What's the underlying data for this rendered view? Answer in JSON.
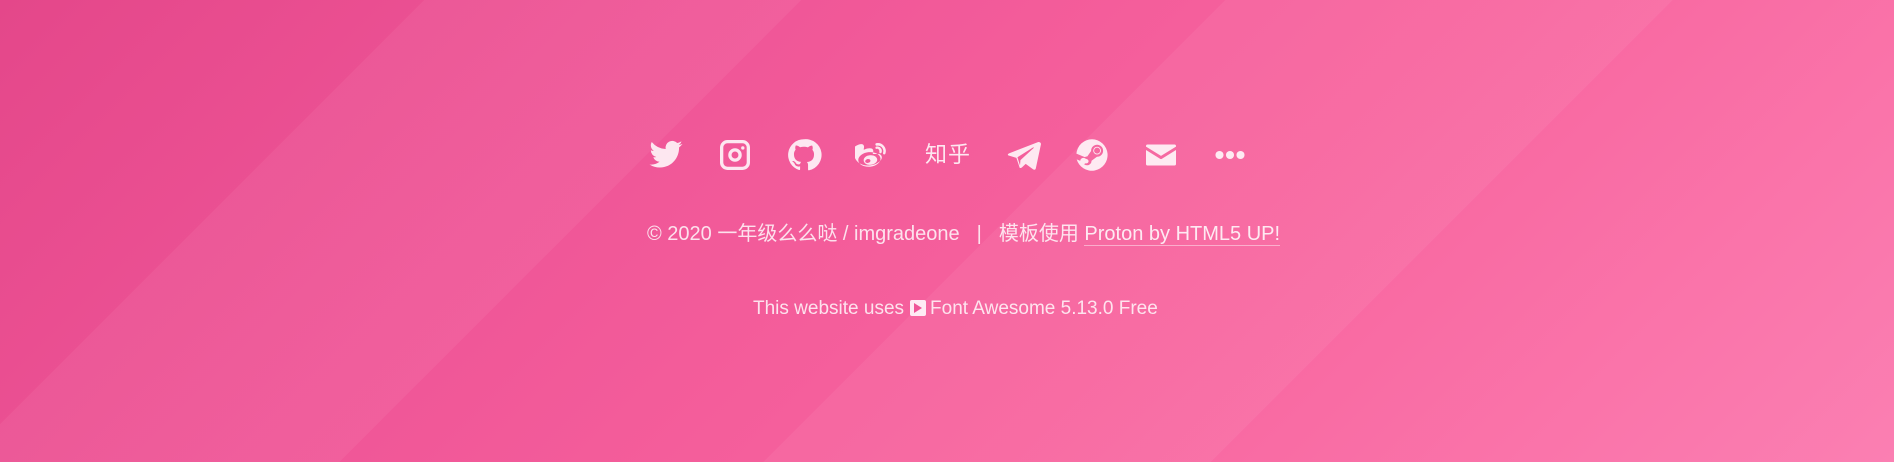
{
  "social": {
    "zhihu_label": "知乎",
    "icons": [
      "twitter-icon",
      "instagram-icon",
      "github-icon",
      "weibo-icon",
      "zhihu-icon",
      "telegram-icon",
      "steam-icon",
      "email-icon",
      "more-icon"
    ]
  },
  "footer": {
    "copyright_prefix": "© 2020 一年级么么哒 / imgradeone",
    "separator": "|",
    "template_label": "模板使用",
    "template_link": "Proton by HTML5 UP!",
    "fa_prefix": "This website uses",
    "fa_text": "Font Awesome 5.13.0 Free"
  },
  "colors": {
    "background_start": "#e4478a",
    "background_end": "#fb7fb2",
    "text": "#ffffff"
  }
}
